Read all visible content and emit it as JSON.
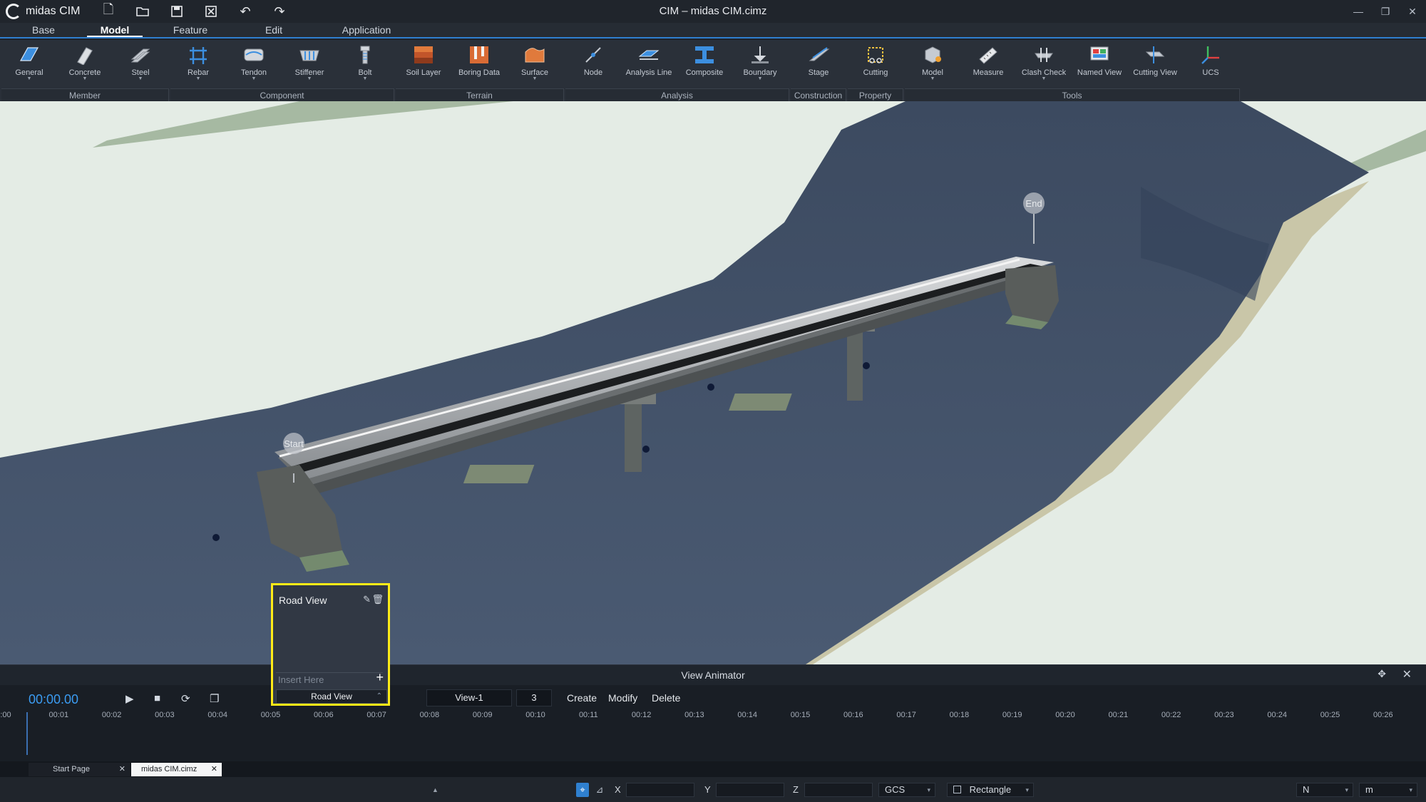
{
  "app": {
    "logo_text": "midas CIM",
    "window_title": "CIM – midas CIM.cimz"
  },
  "ribbon_tabs": [
    "Base",
    "Model",
    "Feature",
    "Edit",
    "Application"
  ],
  "active_tab": "Model",
  "ribbon": {
    "groups": [
      {
        "label": "Member",
        "buttons": [
          "General",
          "Concrete",
          "Steel"
        ]
      },
      {
        "label": "Component",
        "buttons": [
          "Rebar",
          "Tendon",
          "Stiffener",
          "Bolt"
        ]
      },
      {
        "label": "Terrain",
        "buttons": [
          "Soil Layer",
          "Boring Data",
          "Surface"
        ]
      },
      {
        "label": "Analysis",
        "buttons": [
          "Node",
          "Analysis Line",
          "Composite",
          "Boundary"
        ]
      },
      {
        "label": "Construction",
        "buttons": [
          "Stage"
        ]
      },
      {
        "label": "Property",
        "buttons": [
          "Cutting"
        ]
      },
      {
        "label": "Tools",
        "buttons": [
          "Model",
          "Measure",
          "Clash Check",
          "Named View",
          "Cutting View",
          "UCS"
        ]
      }
    ]
  },
  "viewport": {
    "start_label": "Start",
    "end_label": "End"
  },
  "road_view_popup": {
    "title": "Road View",
    "input_placeholder": "Insert Here",
    "selected": "Road View"
  },
  "animator": {
    "title": "View Animator",
    "time": "00:00.00",
    "view_name": "View-1",
    "view_count": "3",
    "actions": {
      "create": "Create",
      "modify": "Modify",
      "delete": "Delete"
    },
    "ticks": [
      ":00",
      "00:01",
      "00:02",
      "00:03",
      "00:04",
      "00:05",
      "00:06",
      "00:07",
      "00:08",
      "00:09",
      "00:10",
      "00:11",
      "00:12",
      "00:13",
      "00:14",
      "00:15",
      "00:16",
      "00:17",
      "00:18",
      "00:19",
      "00:20",
      "00:21",
      "00:22",
      "00:23",
      "00:24",
      "00:25",
      "00:26"
    ]
  },
  "doc_tabs": [
    "Start Page",
    "midas CIM.cimz"
  ],
  "active_doc": "midas CIM.cimz",
  "statusbar": {
    "x_label": "X",
    "y_label": "Y",
    "z_label": "Z",
    "coord_system": "GCS",
    "select_mode": "Rectangle",
    "force_unit": "N",
    "length_unit": "m"
  }
}
